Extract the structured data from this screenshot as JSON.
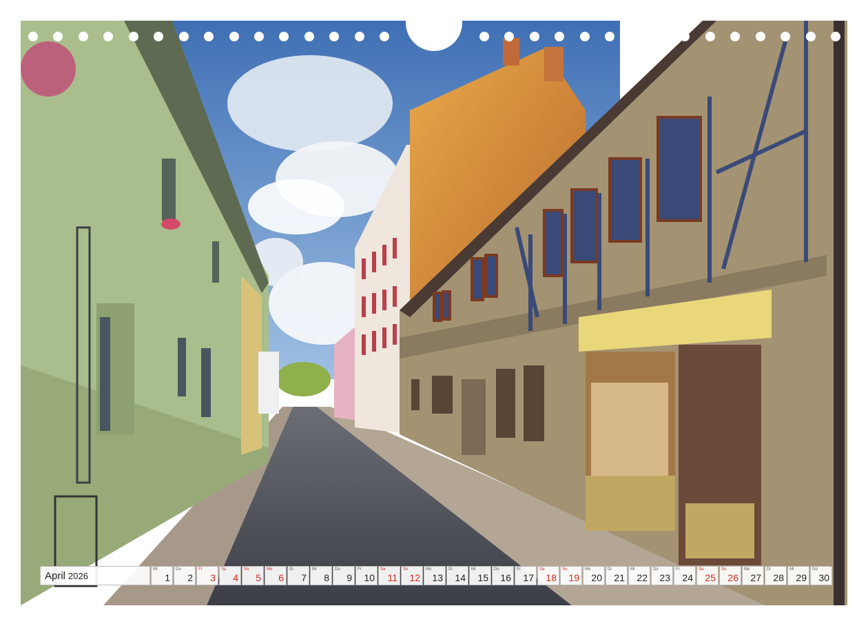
{
  "calendar": {
    "month": "April",
    "year": "2026",
    "days": [
      {
        "wd": "Mi",
        "num": "1",
        "red": false
      },
      {
        "wd": "Do",
        "num": "2",
        "red": false
      },
      {
        "wd": "Fr",
        "num": "3",
        "red": true
      },
      {
        "wd": "Sa",
        "num": "4",
        "red": true
      },
      {
        "wd": "So",
        "num": "5",
        "red": true
      },
      {
        "wd": "Mo",
        "num": "6",
        "red": true
      },
      {
        "wd": "Di",
        "num": "7",
        "red": false
      },
      {
        "wd": "Mi",
        "num": "8",
        "red": false
      },
      {
        "wd": "Do",
        "num": "9",
        "red": false
      },
      {
        "wd": "Fr",
        "num": "10",
        "red": false
      },
      {
        "wd": "Sa",
        "num": "11",
        "red": true
      },
      {
        "wd": "So",
        "num": "12",
        "red": true
      },
      {
        "wd": "Mo",
        "num": "13",
        "red": false
      },
      {
        "wd": "Di",
        "num": "14",
        "red": false
      },
      {
        "wd": "Mi",
        "num": "15",
        "red": false
      },
      {
        "wd": "Do",
        "num": "16",
        "red": false
      },
      {
        "wd": "Fr",
        "num": "17",
        "red": false
      },
      {
        "wd": "Sa",
        "num": "18",
        "red": true
      },
      {
        "wd": "So",
        "num": "19",
        "red": true
      },
      {
        "wd": "Mo",
        "num": "20",
        "red": false
      },
      {
        "wd": "Di",
        "num": "21",
        "red": false
      },
      {
        "wd": "Mi",
        "num": "22",
        "red": false
      },
      {
        "wd": "Do",
        "num": "23",
        "red": false
      },
      {
        "wd": "Fr",
        "num": "24",
        "red": false
      },
      {
        "wd": "Sa",
        "num": "25",
        "red": true
      },
      {
        "wd": "So",
        "num": "26",
        "red": true
      },
      {
        "wd": "Mo",
        "num": "27",
        "red": false
      },
      {
        "wd": "Di",
        "num": "28",
        "red": false
      },
      {
        "wd": "Mi",
        "num": "29",
        "red": false
      },
      {
        "wd": "Do",
        "num": "30",
        "red": false
      }
    ]
  },
  "colors": {
    "holiday_red": "#d0281c",
    "sky": "#4a7fc4",
    "green_facade": "#a9be8c",
    "brick_orange": "#d9913a",
    "timber_blue": "#3a4a78"
  }
}
